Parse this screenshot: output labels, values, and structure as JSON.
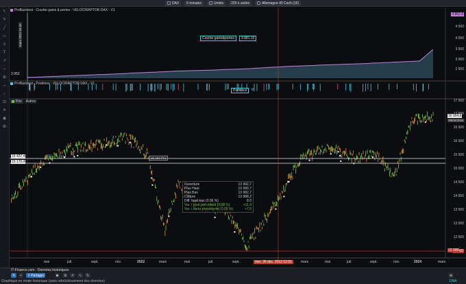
{
  "toolbar": {
    "instrument": "DAX",
    "period": "5 minutes",
    "units_label": "Unités",
    "units_count": "225 k unités",
    "account": "Allemagne 40 Cash (1€)"
  },
  "equity_panel": {
    "title": "ProBacktest - Courbe gains & pertes : VELOCIRAPTOR DAX - V1",
    "tooltip_label": "Courbe gains&pertes",
    "tooltip_value": "3 881,10",
    "axis_labels": [
      "4 862,8",
      "4 500",
      "4 000",
      "3 500",
      "3 000",
      "2 500",
      "2 052"
    ],
    "vertical_date_label": "mars 2021 04:45"
  },
  "positions_panel": {
    "title": "ProBacktest - Positions : VELOCIRAPTOR DAX - V1",
    "tooltip_label": "Positions",
    "tooltip_value": "0"
  },
  "price_panel": {
    "tab_price": "Prix",
    "tab_others": "Autres",
    "axis_labels": [
      "17 500",
      "17 000",
      "16 500",
      "16 000",
      "15 500",
      "15 000",
      "14 500",
      "14 000",
      "13 500",
      "13 000",
      "12 500",
      "12 000"
    ],
    "current_price": "16 954,6",
    "current_date_badge": "09/02/2024",
    "hline1": "15 437,4",
    "hline2": "15 170,4",
    "hline_tag": "15 262 Prix",
    "bottom_level": "12 000",
    "infobox": {
      "rows": [
        {
          "label": "Ouverture",
          "value": "13 982,7"
        },
        {
          "label": "Plus Haut",
          "value": "13 990,7"
        },
        {
          "label": "Plus Bas",
          "value": "13 982,7"
        },
        {
          "label": "Clôture",
          "value": "13 988,2"
        },
        {
          "label": "Diff. haut-bas (0,06 %)",
          "value": "8,0"
        },
        {
          "label": "Var. / pour précédent (0,08 %)",
          "value": "+11,4"
        },
        {
          "label": "Var. / barre précédente (0,05 %)",
          "value": "+7,5"
        }
      ]
    }
  },
  "time_axis": {
    "labels": [
      "mai",
      "juil.",
      "sept.",
      "nov.",
      "2022",
      "mars",
      "mai",
      "juil.",
      "sept.",
      "nov.",
      "2023",
      "mars",
      "mai",
      "juil.",
      "sept.",
      "nov.",
      "2024",
      "mars"
    ],
    "cursor_label": "mer. 28 déc. 2022 02:55"
  },
  "footer": {
    "source": "IT-Finance.com - Données historiques",
    "share_button": "Partager",
    "status": "Graphique en mode historique (sans rafraîchissement des données)",
    "dna": "DNA"
  },
  "colors": {
    "equity_line": "#c77fe0",
    "equity_fill": "#2d4a5a",
    "positions": "#4ec9e0",
    "candle_up": "#6fbf4a",
    "candle_down": "#d08a3a",
    "cursor": "#c0392b",
    "background": "#0b0d10"
  }
}
